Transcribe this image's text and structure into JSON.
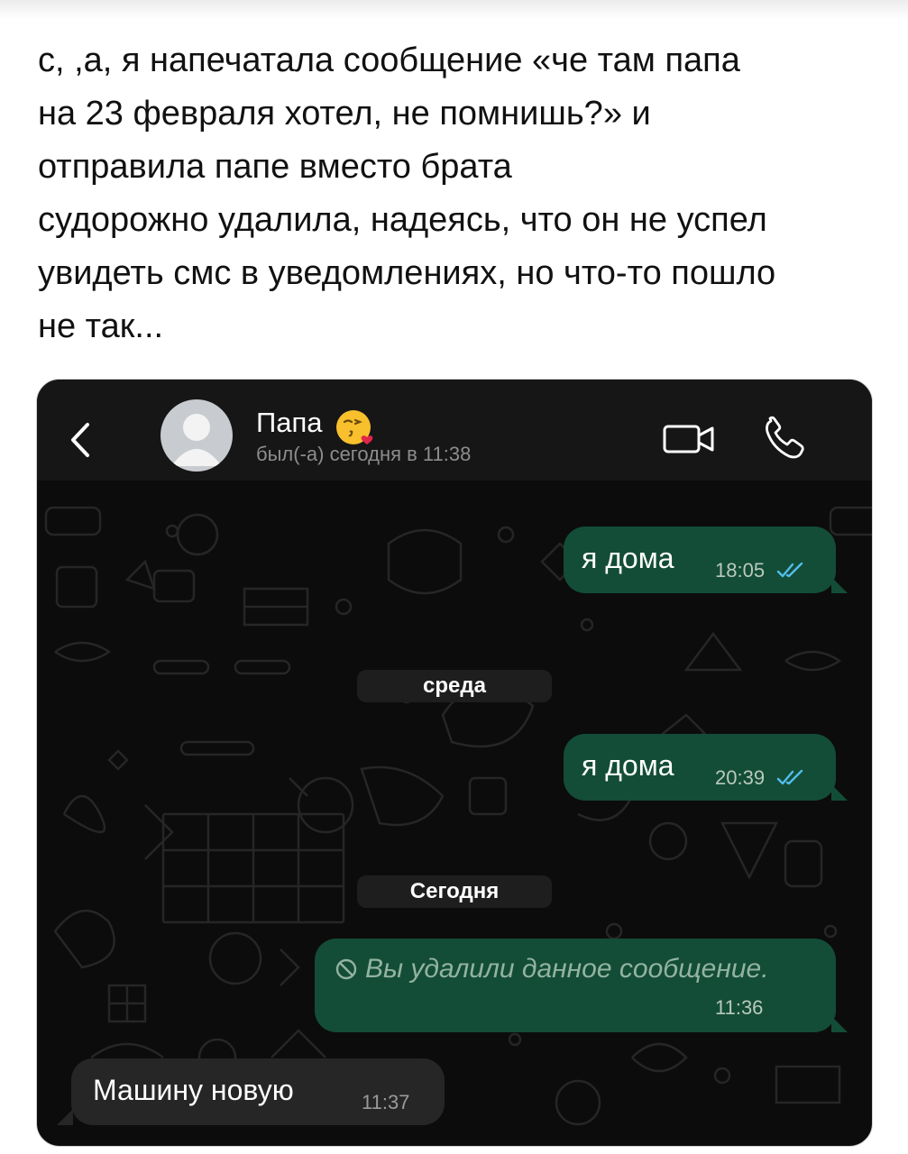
{
  "post": {
    "lines": [
      "с, ,а, я напечатала сообщение «че там папа",
      "на 23 февраля хотел, не помнишь?» и",
      "отправила папе вместо брата",
      "судорожно удалила, надеясь, что он не успел",
      "увидеть смс в уведомлениях, но что-то пошло",
      "не так..."
    ]
  },
  "chat": {
    "contact_name": "Папа",
    "contact_emoji": "face-blowing-kiss-emoji",
    "last_seen": "был(-а) сегодня в 11:38",
    "icons": {
      "back": "chevron-left-icon",
      "video": "video-camera-icon",
      "call": "phone-icon",
      "avatar": "default-avatar-icon",
      "read": "double-check-icon",
      "deleted": "prohibited-icon"
    },
    "colors": {
      "bg": "#0c0c0c",
      "header": "#161616",
      "outgoing": "#134d37",
      "incoming": "#262626",
      "tick": "#53bdeb"
    },
    "messages": [
      {
        "direction": "out",
        "text": "я дома",
        "time": "18:05",
        "status": "read"
      },
      {
        "type": "date",
        "label": "среда"
      },
      {
        "direction": "out",
        "text": "я дома",
        "time": "20:39",
        "status": "read"
      },
      {
        "type": "date",
        "label": "Сегодня"
      },
      {
        "direction": "out",
        "deleted": true,
        "text": "Вы удалили данное сообщение.",
        "time": "11:36"
      },
      {
        "direction": "in",
        "text": "Машину новую",
        "time": "11:37"
      }
    ]
  }
}
